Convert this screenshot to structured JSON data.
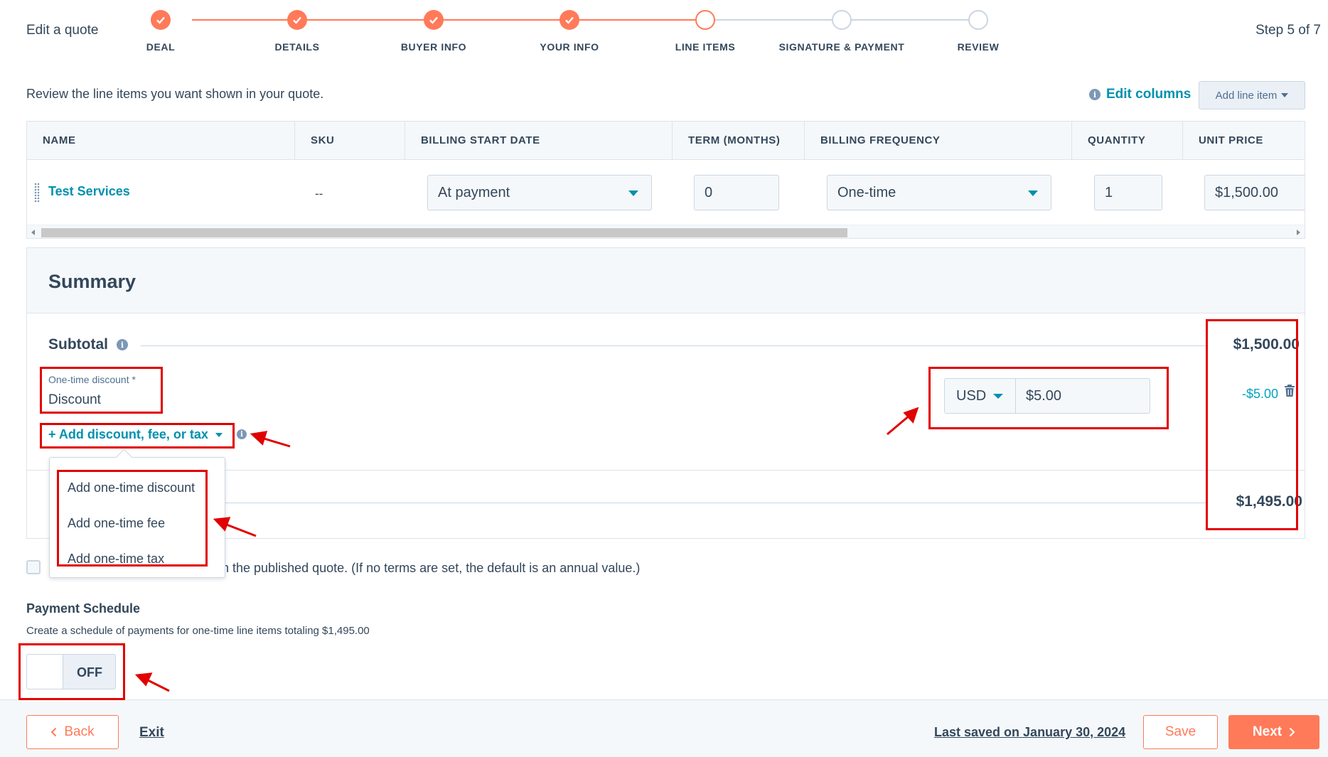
{
  "header": {
    "title": "Edit a quote",
    "step_count": "Step 5 of 7"
  },
  "steps": [
    {
      "label": "DEAL",
      "state": "done"
    },
    {
      "label": "DETAILS",
      "state": "done"
    },
    {
      "label": "BUYER INFO",
      "state": "done"
    },
    {
      "label": "YOUR INFO",
      "state": "done"
    },
    {
      "label": "LINE ITEMS",
      "state": "current"
    },
    {
      "label": "SIGNATURE & PAYMENT",
      "state": "todo"
    },
    {
      "label": "REVIEW",
      "state": "todo"
    }
  ],
  "intro": {
    "text": "Review the line items you want shown in your quote.",
    "edit_columns": "Edit columns",
    "add_line_item": "Add line item"
  },
  "table": {
    "columns": [
      "NAME",
      "SKU",
      "BILLING START DATE",
      "TERM (MONTHS)",
      "BILLING FREQUENCY",
      "QUANTITY",
      "UNIT PRICE"
    ],
    "row": {
      "name": "Test Services",
      "sku": "--",
      "billing_start_date": "At payment",
      "term": "0",
      "billing_frequency": "One-time",
      "quantity": "1",
      "unit_price": "$1,500.00"
    }
  },
  "summary": {
    "title": "Summary",
    "subtotal_label": "Subtotal",
    "subtotal_value": "$1,500.00",
    "discount_field_label": "One-time discount *",
    "discount_name": "Discount",
    "currency": "USD",
    "discount_amount": "$5.00",
    "discount_value": "-$5.00",
    "add_action": "+ Add discount, fee, or tax",
    "total_value": "$1,495.00"
  },
  "menu": {
    "items": [
      "Add one-time discount",
      "Add one-time fee",
      "Add one-time tax"
    ]
  },
  "checkbox_text": "n the published quote. (If no terms are set, the default is an annual value.)",
  "payment_schedule": {
    "title": "Payment Schedule",
    "description": "Create a schedule of payments for one-time line items totaling $1,495.00",
    "toggle_state": "OFF"
  },
  "footer": {
    "back": "Back",
    "exit": "Exit",
    "last_saved": "Last saved on January 30, 2024",
    "save": "Save",
    "next": "Next"
  },
  "colors": {
    "accent": "#ff7a59",
    "link": "#0091ae",
    "text": "#33475b",
    "annotation": "#e10000"
  }
}
